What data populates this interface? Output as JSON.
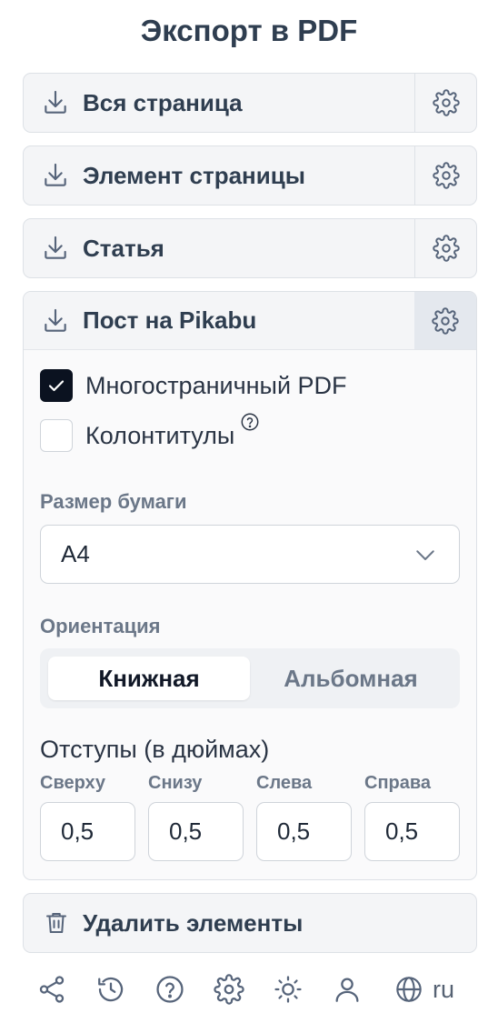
{
  "title": "Экспорт в PDF",
  "actions": [
    {
      "label": "Вся страница"
    },
    {
      "label": "Элемент страницы"
    },
    {
      "label": "Статья"
    },
    {
      "label": "Пост на Pikabu"
    }
  ],
  "options": {
    "multipage": {
      "label": "Многостраничный PDF",
      "checked": true
    },
    "headers": {
      "label": "Колонтитулы",
      "checked": false
    }
  },
  "paper_size": {
    "label": "Размер бумаги",
    "value": "A4"
  },
  "orientation": {
    "label": "Ориентация",
    "options": [
      "Книжная",
      "Альбомная"
    ],
    "selected": "Книжная"
  },
  "margins": {
    "title": "Отступы (в дюймах)",
    "fields": [
      {
        "label": "Сверху",
        "value": "0,5"
      },
      {
        "label": "Снизу",
        "value": "0,5"
      },
      {
        "label": "Слева",
        "value": "0,5"
      },
      {
        "label": "Справа",
        "value": "0,5"
      }
    ]
  },
  "delete_label": "Удалить элементы",
  "footer": {
    "language": "ru"
  },
  "colors": {
    "text_dark": "#2f3e50",
    "muted": "#6b7788",
    "checkbox_on": "#0b1220",
    "panel_bg": "#f4f5f7"
  }
}
